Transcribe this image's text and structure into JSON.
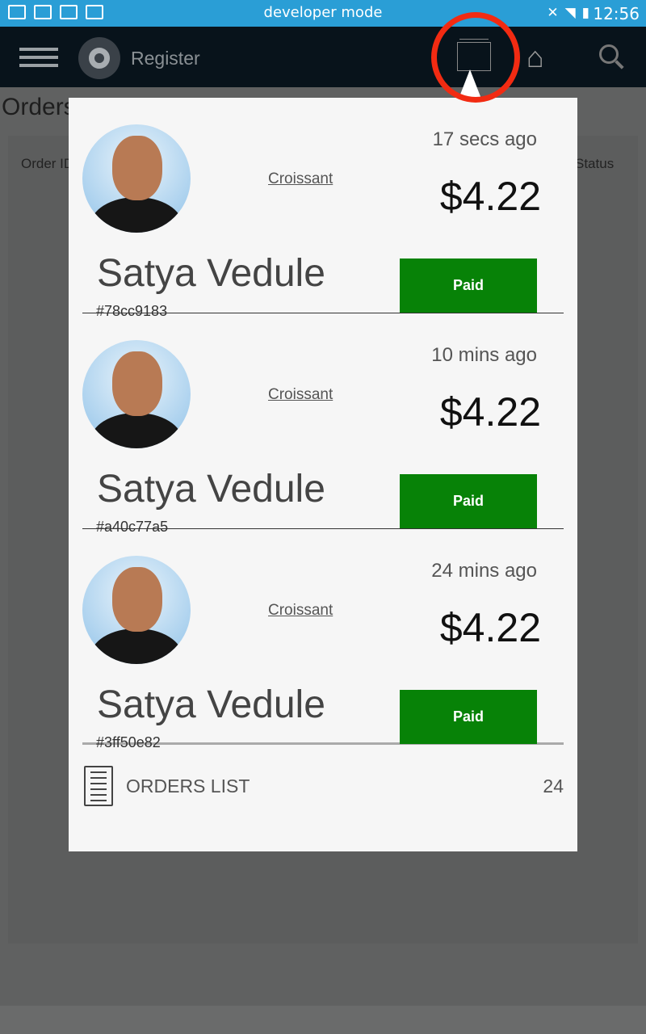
{
  "status_bar": {
    "title": "developer mode",
    "time": "12:56"
  },
  "app_bar": {
    "brand": "Register",
    "icons": [
      "menu-icon",
      "logo-icon",
      "orders-tray-icon",
      "home-icon",
      "search-icon"
    ]
  },
  "background": {
    "title": "Orders",
    "col_order_id": "Order ID",
    "col_status": "Status"
  },
  "popup": {
    "orders": [
      {
        "ago": "17 secs ago",
        "item": "Croissant",
        "price": "$4.22",
        "name": "Satya Vedule",
        "id": "#78cc9183",
        "status": "Paid"
      },
      {
        "ago": "10 mins ago",
        "item": "Croissant",
        "price": "$4.22",
        "name": "Satya Vedule",
        "id": "#a40c77a5",
        "status": "Paid"
      },
      {
        "ago": "24 mins ago",
        "item": "Croissant",
        "price": "$4.22",
        "name": "Satya Vedule",
        "id": "#3ff50e82",
        "status": "Paid"
      }
    ],
    "footer": {
      "label": "ORDERS LIST",
      "count": "24"
    }
  },
  "colors": {
    "status_bar": "#2a9ed6",
    "app_bar": "#08131b",
    "paid": "#078207",
    "highlight_ring": "#f22b12"
  }
}
